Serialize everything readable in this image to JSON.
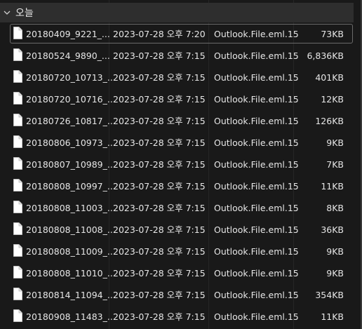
{
  "group": {
    "title": "오늘"
  },
  "files": [
    {
      "name": "20180409_9221_...",
      "date": "2023-07-28 오후 7:20",
      "type": "Outlook.File.eml.15",
      "size": "73KB",
      "selected": true
    },
    {
      "name": "20180524_9890_...",
      "date": "2023-07-28 오후 7:15",
      "type": "Outlook.File.eml.15",
      "size": "6,836KB"
    },
    {
      "name": "20180720_10713_...",
      "date": "2023-07-28 오후 7:15",
      "type": "Outlook.File.eml.15",
      "size": "401KB"
    },
    {
      "name": "20180720_10716_...",
      "date": "2023-07-28 오후 7:15",
      "type": "Outlook.File.eml.15",
      "size": "12KB"
    },
    {
      "name": "20180726_10817_...",
      "date": "2023-07-28 오후 7:15",
      "type": "Outlook.File.eml.15",
      "size": "126KB"
    },
    {
      "name": "20180806_10973_...",
      "date": "2023-07-28 오후 7:15",
      "type": "Outlook.File.eml.15",
      "size": "9KB"
    },
    {
      "name": "20180807_10989_...",
      "date": "2023-07-28 오후 7:15",
      "type": "Outlook.File.eml.15",
      "size": "7KB"
    },
    {
      "name": "20180808_10997_...",
      "date": "2023-07-28 오후 7:15",
      "type": "Outlook.File.eml.15",
      "size": "11KB"
    },
    {
      "name": "20180808_11003_...",
      "date": "2023-07-28 오후 7:15",
      "type": "Outlook.File.eml.15",
      "size": "8KB"
    },
    {
      "name": "20180808_11008_...",
      "date": "2023-07-28 오후 7:15",
      "type": "Outlook.File.eml.15",
      "size": "36KB"
    },
    {
      "name": "20180808_11009_...",
      "date": "2023-07-28 오후 7:15",
      "type": "Outlook.File.eml.15",
      "size": "9KB"
    },
    {
      "name": "20180808_11010_...",
      "date": "2023-07-28 오후 7:15",
      "type": "Outlook.File.eml.15",
      "size": "9KB"
    },
    {
      "name": "20180814_11094_...",
      "date": "2023-07-28 오후 7:15",
      "type": "Outlook.File.eml.15",
      "size": "354KB"
    },
    {
      "name": "20180908_11483_...",
      "date": "2023-07-28 오후 7:15",
      "type": "Outlook.File.eml.15",
      "size": "11KB"
    }
  ],
  "icons": {
    "group_toggle": "chevron-down-icon",
    "file": "document-file-icon"
  },
  "colors": {
    "background": "#191919",
    "group_header": "#2e2e2e",
    "text": "#e6e6e6",
    "selection_border": "#6b6b6b"
  }
}
